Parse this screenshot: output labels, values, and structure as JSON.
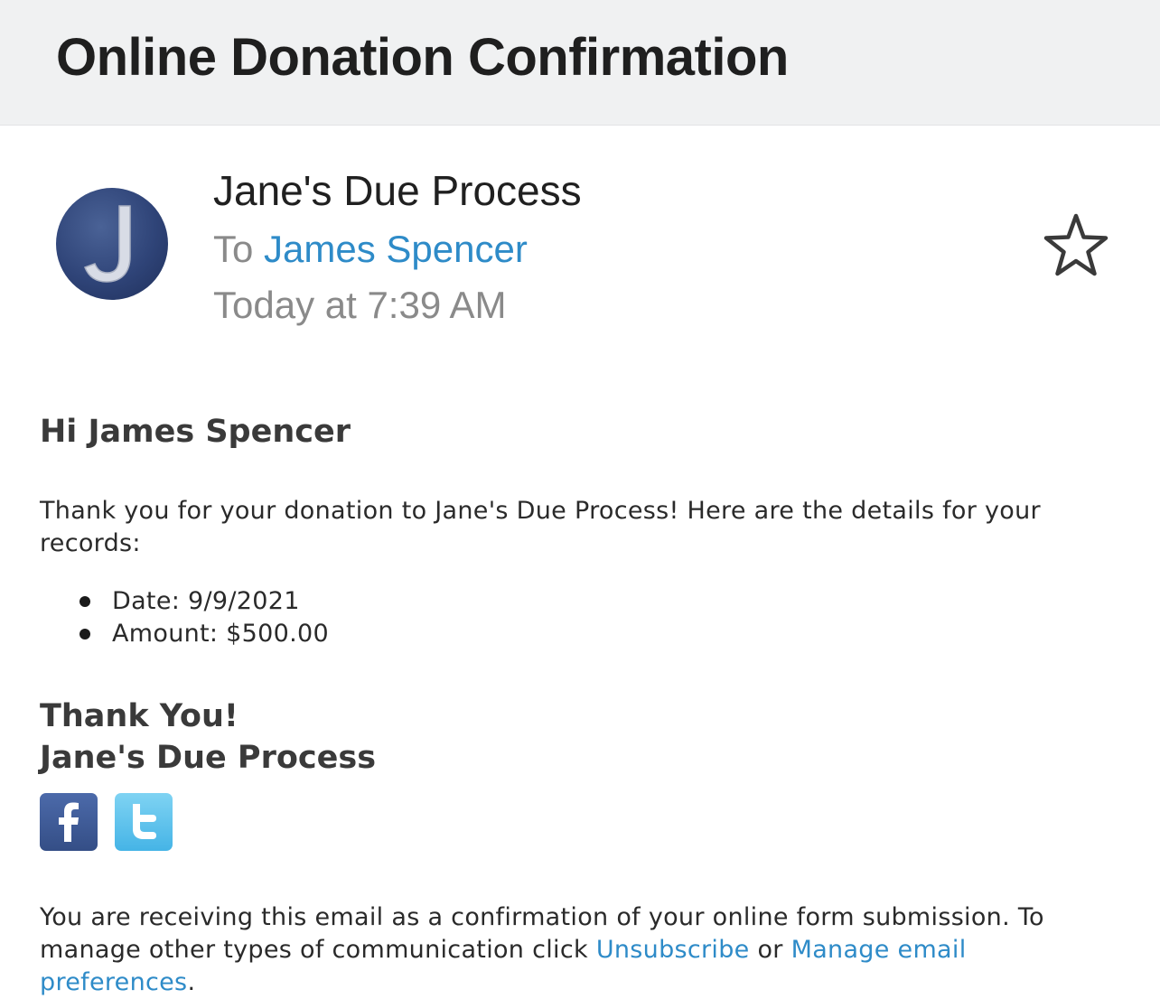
{
  "email": {
    "subject": "Online Donation Confirmation",
    "avatar_letter": "J",
    "sender": "Jane's Due Process",
    "to_prefix": "To",
    "recipient": "James Spencer",
    "timestamp": "Today at 7:39 AM",
    "star_icon": "star-outline-icon"
  },
  "body": {
    "greeting": "Hi James Spencer",
    "intro": "Thank you for your donation to Jane's Due Process! Here are the details for your records:",
    "details": [
      {
        "text": "Date: 9/9/2021"
      },
      {
        "text": "Amount: $500.00"
      }
    ],
    "thanks": "Thank You!",
    "signature": "Jane's Due Process"
  },
  "social": {
    "facebook_icon": "facebook-icon",
    "twitter_icon": "twitter-icon",
    "facebook_color": "#3b5998",
    "twitter_color": "#55acee"
  },
  "footer": {
    "text_before": "You are receiving this email as a confirmation of your online form submission. To manage other types of communication click",
    "unsubscribe_label": "Unsubscribe",
    "connector": "or",
    "manage_label": "Manage email preferences",
    "end_punct": "."
  },
  "colors": {
    "link": "#2e8bc8",
    "header_bg": "#f0f1f2",
    "avatar_bg": "#2f4478"
  }
}
